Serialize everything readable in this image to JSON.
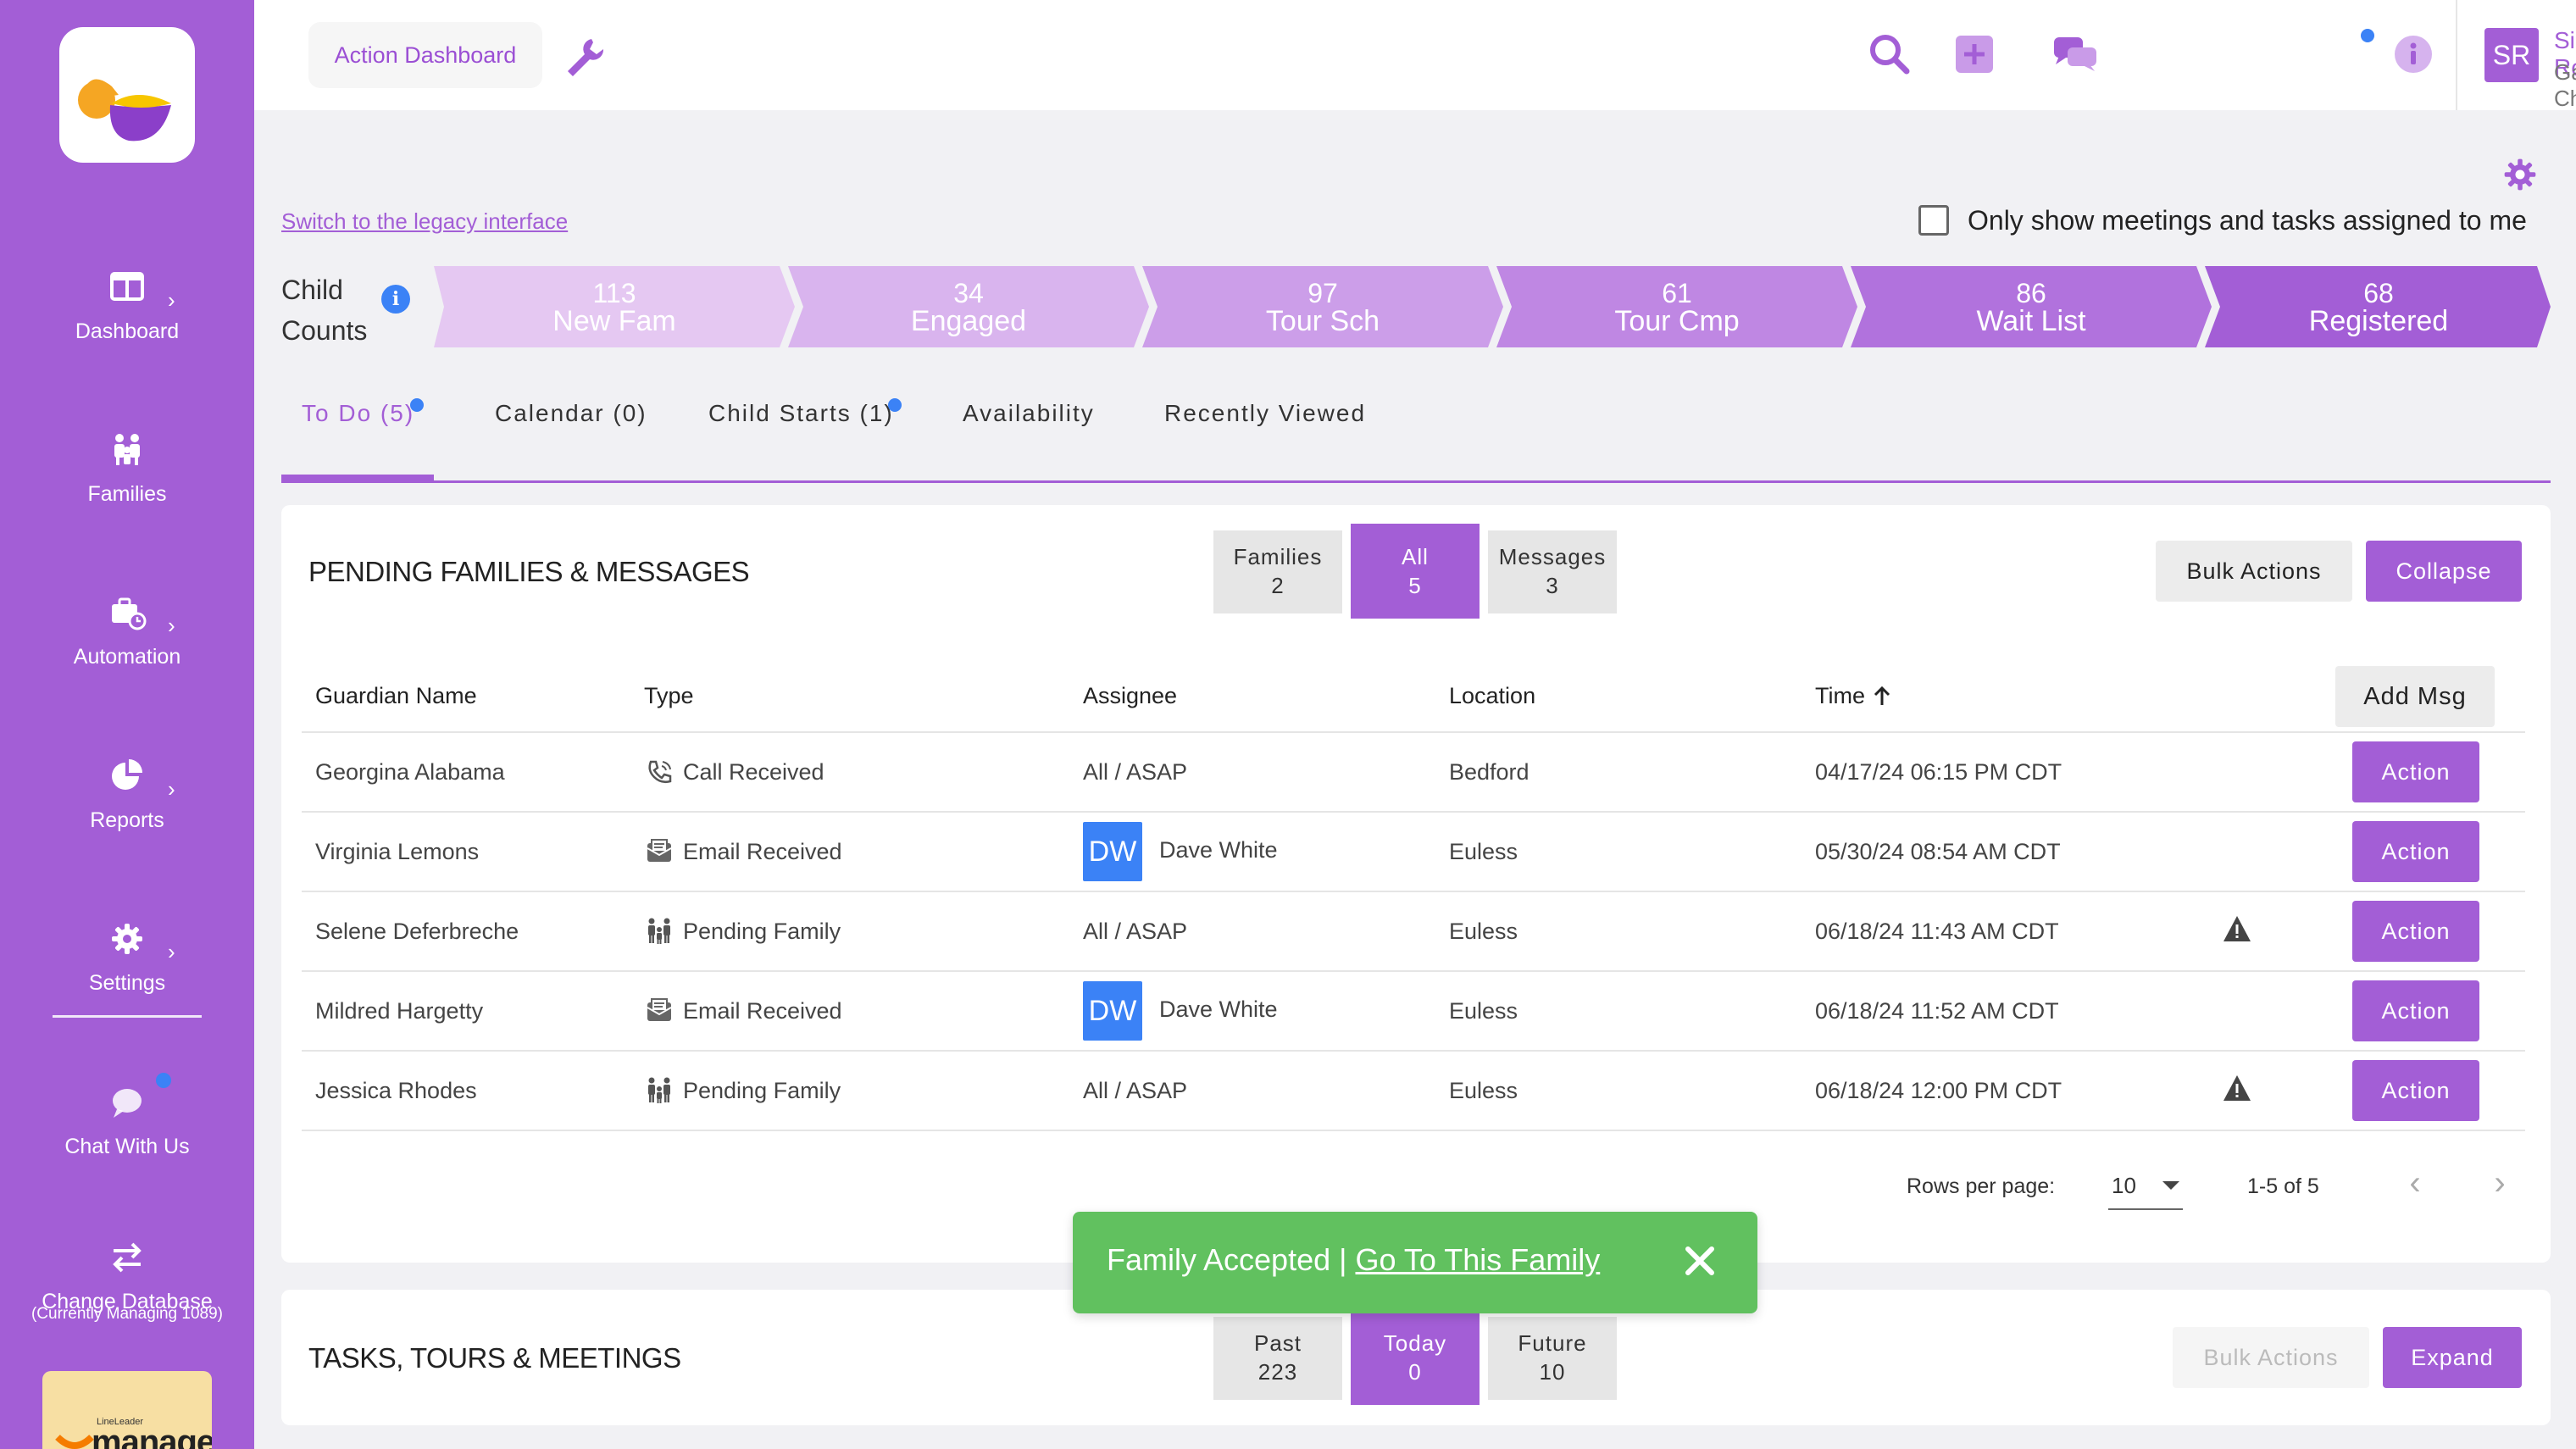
{
  "sidebar": {
    "items": [
      {
        "label": "Dashboard",
        "icon": "dashboard-icon"
      },
      {
        "label": "Families",
        "icon": "families-icon"
      },
      {
        "label": "Automation",
        "icon": "briefcase-clock-icon"
      },
      {
        "label": "Reports",
        "icon": "pie-chart-icon"
      },
      {
        "label": "Settings",
        "icon": "gear-icon"
      },
      {
        "label": "Chat With Us",
        "icon": "chat-bubble-icon"
      },
      {
        "label": "Change Database",
        "icon": "swap-arrows-icon"
      }
    ],
    "db_sub": "(Currently Managing 1089)",
    "brand_small": "LineLeader",
    "brand_big": "manage"
  },
  "header": {
    "breadcrumb": "Action Dashboard",
    "user_initials": "SR",
    "user_name": "Sierra Rossing",
    "user_org": "Gaia Childcare"
  },
  "main": {
    "legacy_link": "Switch to the legacy interface",
    "only_show_label": "Only show meetings and tasks assigned to me",
    "child_counts_label_1": "Child",
    "child_counts_label_2": "Counts",
    "funnel": [
      {
        "count": "113",
        "label": "New Fam",
        "color": "#e5c8f2"
      },
      {
        "count": "34",
        "label": "Engaged",
        "color": "#d9b4ee"
      },
      {
        "count": "97",
        "label": "Tour Sch",
        "color": "#cc9ee9"
      },
      {
        "count": "61",
        "label": "Tour Cmp",
        "color": "#bf87e3"
      },
      {
        "count": "86",
        "label": "Wait List",
        "color": "#b172dd"
      },
      {
        "count": "68",
        "label": "Registered",
        "color": "#a35ed6"
      }
    ],
    "tabs": [
      {
        "label": "To Do (5)"
      },
      {
        "label": "Calendar (0)"
      },
      {
        "label": "Child Starts (1)"
      },
      {
        "label": "Availability"
      },
      {
        "label": "Recently Viewed"
      }
    ]
  },
  "pending": {
    "title": "PENDING FAMILIES & MESSAGES",
    "filters": [
      {
        "label": "Families",
        "count": "2"
      },
      {
        "label": "All",
        "count": "5"
      },
      {
        "label": "Messages",
        "count": "3"
      }
    ],
    "bulk_label": "Bulk Actions",
    "collapse_label": "Collapse",
    "columns": {
      "guardian": "Guardian Name",
      "type": "Type",
      "assignee": "Assignee",
      "location": "Location",
      "time": "Time",
      "add_msg": "Add Msg"
    },
    "rows": [
      {
        "guardian": "Georgina Alabama",
        "type": "Call Received",
        "type_icon": "phone-call-icon",
        "assignee": "All / ASAP",
        "assignee_badge": "",
        "location": "Bedford",
        "time": "04/17/24 06:15 PM CDT",
        "warning": false,
        "action": "Action"
      },
      {
        "guardian": "Virginia Lemons",
        "type": "Email Received",
        "type_icon": "email-icon",
        "assignee": "Dave White",
        "assignee_badge": "DW",
        "location": "Euless",
        "time": "05/30/24 08:54 AM CDT",
        "warning": false,
        "action": "Action"
      },
      {
        "guardian": "Selene Deferbreche",
        "type": "Pending Family",
        "type_icon": "family-icon",
        "assignee": "All / ASAP",
        "assignee_badge": "",
        "location": "Euless",
        "time": "06/18/24 11:43 AM CDT",
        "warning": true,
        "action": "Action"
      },
      {
        "guardian": "Mildred Hargetty",
        "type": "Email Received",
        "type_icon": "email-icon",
        "assignee": "Dave White",
        "assignee_badge": "DW",
        "location": "Euless",
        "time": "06/18/24 11:52 AM CDT",
        "warning": false,
        "action": "Action"
      },
      {
        "guardian": "Jessica Rhodes",
        "type": "Pending Family",
        "type_icon": "family-icon",
        "assignee": "All / ASAP",
        "assignee_badge": "",
        "location": "Euless",
        "time": "06/18/24 12:00 PM CDT",
        "warning": true,
        "action": "Action"
      }
    ],
    "rows_per_page_label": "Rows per page:",
    "rows_per_page": "10",
    "range": "1-5 of 5"
  },
  "tasks": {
    "title": "TASKS, TOURS & MEETINGS",
    "filters": [
      {
        "label": "Past",
        "count": "223"
      },
      {
        "label": "Today",
        "count": "0"
      },
      {
        "label": "Future",
        "count": "10"
      }
    ],
    "bulk_label": "Bulk Actions",
    "expand_label": "Expand"
  },
  "toast": {
    "message": "Family Accepted |",
    "link": "Go To This Family"
  },
  "colors": {
    "accent": "#a35ed6",
    "info": "#3b82f6",
    "success": "#61c15f"
  }
}
